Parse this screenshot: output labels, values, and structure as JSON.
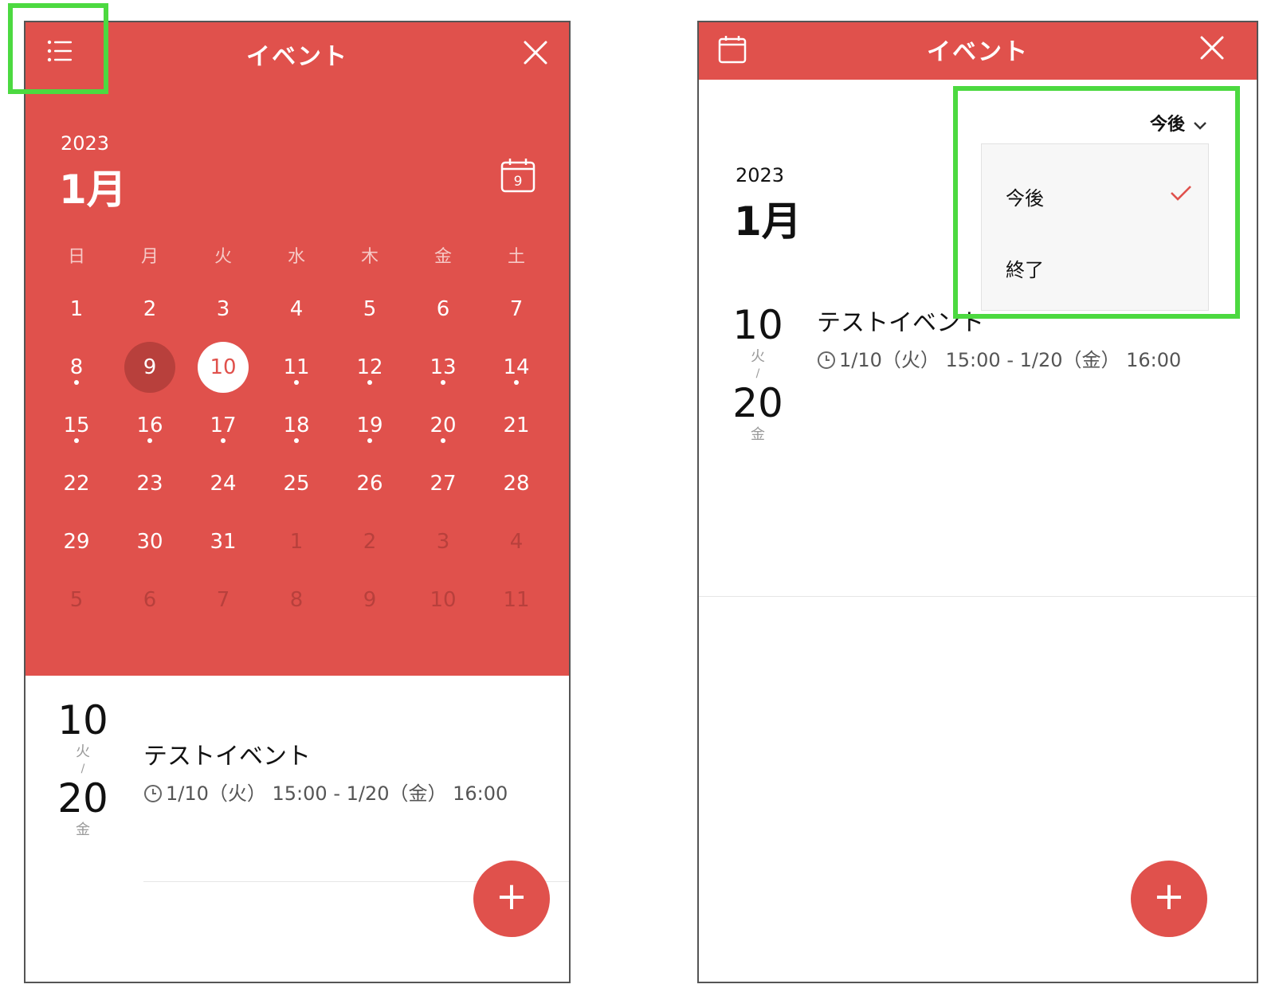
{
  "colors": {
    "accent": "#e0514c",
    "accent_dark": "#b8403c",
    "highlight": "#4cd940"
  },
  "left_screen": {
    "header": {
      "title": "イベント",
      "menu_icon": "list-icon",
      "close_icon": "close-icon"
    },
    "calendar": {
      "year": "2023",
      "month": "1月",
      "today_button": {
        "icon": "calendar-today-icon",
        "label": "9"
      },
      "weekdays": [
        "日",
        "月",
        "火",
        "水",
        "木",
        "金",
        "土"
      ],
      "weeks": [
        [
          {
            "day": "1"
          },
          {
            "day": "2"
          },
          {
            "day": "3"
          },
          {
            "day": "4"
          },
          {
            "day": "5"
          },
          {
            "day": "6"
          },
          {
            "day": "7"
          }
        ],
        [
          {
            "day": "8",
            "event": true
          },
          {
            "day": "9",
            "today": true
          },
          {
            "day": "10",
            "selected": true
          },
          {
            "day": "11",
            "event": true
          },
          {
            "day": "12",
            "event": true
          },
          {
            "day": "13",
            "event": true
          },
          {
            "day": "14",
            "event": true
          }
        ],
        [
          {
            "day": "15",
            "event": true
          },
          {
            "day": "16",
            "event": true
          },
          {
            "day": "17",
            "event": true
          },
          {
            "day": "18",
            "event": true
          },
          {
            "day": "19",
            "event": true
          },
          {
            "day": "20",
            "event": true
          },
          {
            "day": "21"
          }
        ],
        [
          {
            "day": "22"
          },
          {
            "day": "23"
          },
          {
            "day": "24"
          },
          {
            "day": "25"
          },
          {
            "day": "26"
          },
          {
            "day": "27"
          },
          {
            "day": "28"
          }
        ],
        [
          {
            "day": "29"
          },
          {
            "day": "30"
          },
          {
            "day": "31"
          },
          {
            "day": "1",
            "other": true
          },
          {
            "day": "2",
            "other": true
          },
          {
            "day": "3",
            "other": true
          },
          {
            "day": "4",
            "other": true
          }
        ],
        [
          {
            "day": "5",
            "other": true
          },
          {
            "day": "6",
            "other": true
          },
          {
            "day": "7",
            "other": true
          },
          {
            "day": "8",
            "other": true
          },
          {
            "day": "9",
            "other": true
          },
          {
            "day": "10",
            "other": true
          },
          {
            "day": "11",
            "other": true
          }
        ]
      ]
    },
    "event": {
      "start_day": "10",
      "start_weekday": "火",
      "separator": "/",
      "end_day": "20",
      "end_weekday": "金",
      "title": "テストイベント",
      "time": "1/10（火） 15:00 - 1/20（金） 16:00"
    },
    "fab_label": "+"
  },
  "right_screen": {
    "header": {
      "title": "イベント",
      "calendar_icon": "calendar-icon",
      "close_icon": "close-icon"
    },
    "year": "2023",
    "month": "1月",
    "filter": {
      "selected": "今後",
      "options": [
        {
          "label": "今後",
          "checked": true
        },
        {
          "label": "終了",
          "checked": false
        }
      ]
    },
    "event": {
      "start_day": "10",
      "start_weekday": "火",
      "separator": "/",
      "end_day": "20",
      "end_weekday": "金",
      "title": "テストイベント",
      "time": "1/10（火） 15:00 - 1/20（金） 16:00"
    },
    "fab_label": "+"
  }
}
